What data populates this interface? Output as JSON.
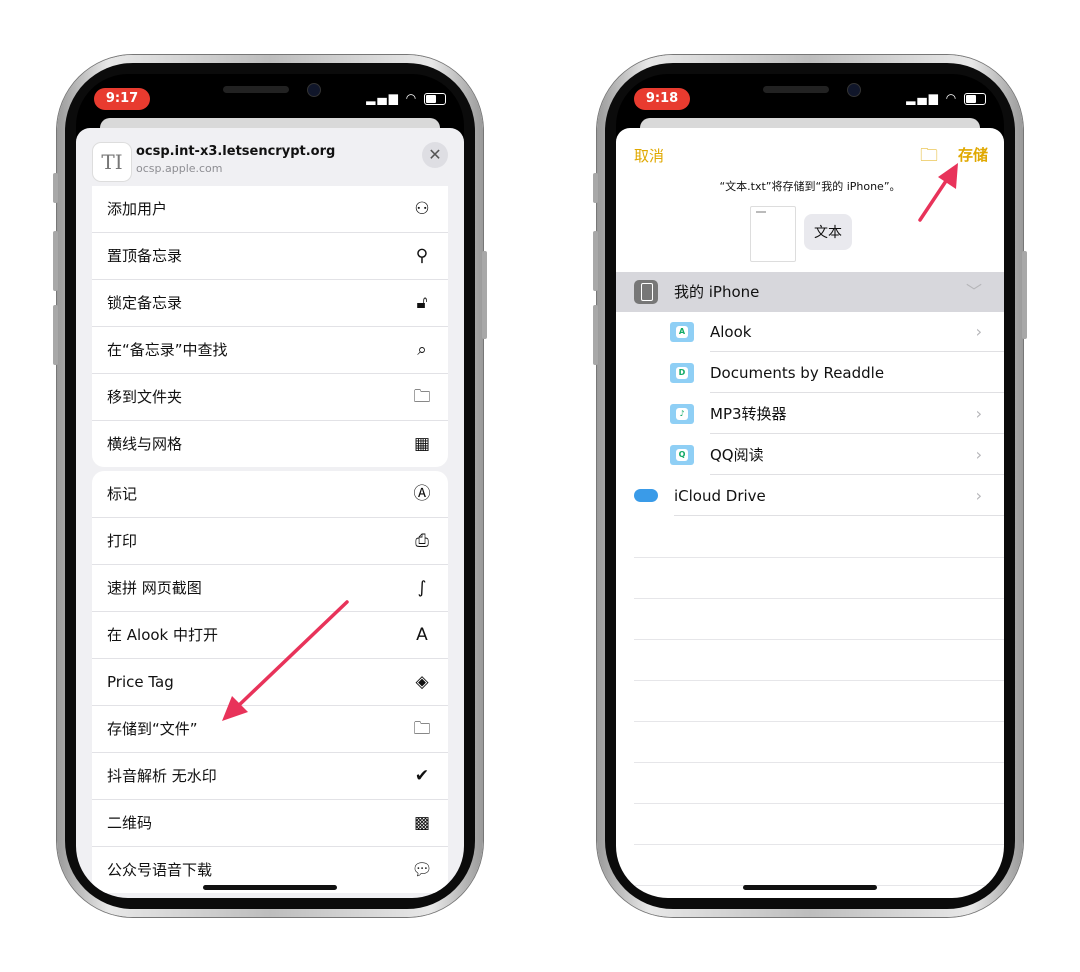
{
  "left_phone": {
    "time": "9:17",
    "header": {
      "icon_text": "TI",
      "title": "ocsp.int-x3.letsencrypt.org",
      "subtitle": "ocsp.apple.com",
      "close": "✕"
    },
    "group1": [
      {
        "label": "添加用户",
        "icon": "add-user-icon"
      },
      {
        "label": "置顶备忘录",
        "icon": "pin-icon"
      },
      {
        "label": "锁定备忘录",
        "icon": "lock-icon"
      },
      {
        "label": "在“备忘录”中查找",
        "icon": "search-icon"
      },
      {
        "label": "移到文件夹",
        "icon": "folder-icon"
      },
      {
        "label": "横线与网格",
        "icon": "grid-icon"
      }
    ],
    "group2": [
      {
        "label": "标记",
        "icon": "markup-icon"
      },
      {
        "label": "打印",
        "icon": "print-icon"
      },
      {
        "label": "速拼 网页截图",
        "icon": "shortcut-icon"
      },
      {
        "label": "在 Alook 中打开",
        "icon": "alook-icon"
      },
      {
        "label": "Price Tag",
        "icon": "tag-icon"
      },
      {
        "label": "存储到“文件”",
        "icon": "folder-icon"
      },
      {
        "label": "抖音解析 无水印",
        "icon": "check-icon"
      },
      {
        "label": "二维码",
        "icon": "qrcode-icon"
      },
      {
        "label": "公众号语音下载",
        "icon": "chat-icon"
      }
    ],
    "glyphs": {
      "add-user-icon": "⚇",
      "pin-icon": "⚲",
      "lock-icon": "🔓︎",
      "search-icon": "⌕",
      "folder-icon": "🗀",
      "grid-icon": "▦",
      "markup-icon": "Ⓐ",
      "print-icon": "⎙",
      "shortcut-icon": "∫",
      "alook-icon": "A",
      "tag-icon": "◈",
      "check-icon": "✔",
      "qrcode-icon": "▩",
      "chat-icon": "💬︎"
    }
  },
  "right_phone": {
    "time": "9:18",
    "cancel": "取消",
    "save": "存储",
    "message": "“文本.txt”将存储到“我的 iPhone”。",
    "file_name": "文本",
    "locations": [
      {
        "label": "我的 iPhone",
        "icon": "phone-icon",
        "chevron": "﹀",
        "selected": true
      },
      {
        "label": "Alook",
        "icon": "alook-folder-icon",
        "badge": "A",
        "chevron": "›"
      },
      {
        "label": "Documents by Readdle",
        "icon": "documents-folder-icon",
        "badge": "D",
        "chevron": ""
      },
      {
        "label": "MP3转换器",
        "icon": "mp3-folder-icon",
        "badge": "♪",
        "chevron": "›"
      },
      {
        "label": "QQ阅读",
        "icon": "qq-folder-icon",
        "badge": "Q",
        "chevron": "›"
      },
      {
        "label": "iCloud Drive",
        "icon": "icloud-icon",
        "chevron": "›"
      }
    ]
  },
  "colors": {
    "accent": "#e0a800",
    "arrow": "#e8335a",
    "time_pill": "#e83b2f",
    "selected_row": "#d7d7dc"
  }
}
